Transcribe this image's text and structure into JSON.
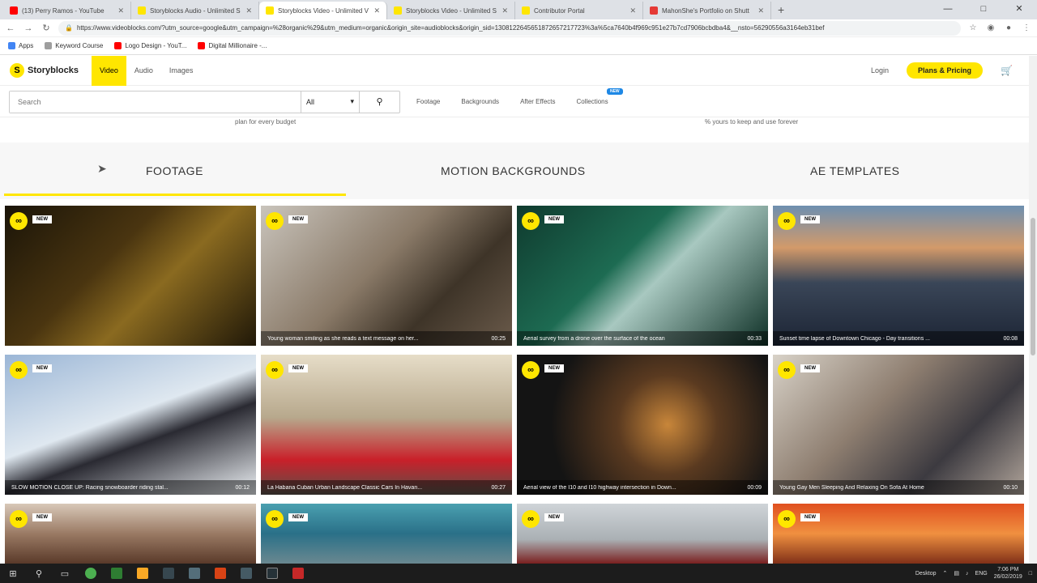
{
  "browser": {
    "tabs": [
      {
        "title": "(13) Perry Ramos - YouTube",
        "color": "#ff0000",
        "active": false
      },
      {
        "title": "Storyblocks Audio - Unlimited S",
        "color": "#ffe600",
        "active": false
      },
      {
        "title": "Storyblocks Video - Unlimited V",
        "color": "#ffe600",
        "active": true
      },
      {
        "title": "Storyblocks Video - Unlimited S",
        "color": "#ffe600",
        "active": false
      },
      {
        "title": "Contributor Portal",
        "color": "#ffe600",
        "active": false
      },
      {
        "title": "MahonShe's Portfolio on Shutt",
        "color": "#e53935",
        "active": false
      }
    ],
    "new_tab": "+",
    "url": "https://www.videoblocks.com/?utm_source=google&utm_campaign=%28organic%29&utm_medium=organic&origin_site=audioblocks&origin_sid=1308122645651872657217723%3a%5ca7640b4f969c951e27b7cd7906bcbdba4&__nsto=56290556a3164eb31bef",
    "bookmarks": [
      {
        "label": "Apps",
        "color": "#4285f4"
      },
      {
        "label": "Keyword Course",
        "color": "#9e9e9e"
      },
      {
        "label": "Logo Design - YouT...",
        "color": "#ff0000"
      },
      {
        "label": "Digital Millionaire -...",
        "color": "#ff0000"
      }
    ]
  },
  "site": {
    "logo_text": "Storyblocks",
    "logo_mark": "S",
    "nav": [
      {
        "label": "Video",
        "active": true
      },
      {
        "label": "Audio",
        "active": false
      },
      {
        "label": "Images",
        "active": false
      }
    ],
    "login": "Login",
    "plans": "Plans & Pricing",
    "search": {
      "placeholder": "Search",
      "select": "All"
    },
    "subnav": [
      "Footage",
      "Backgrounds",
      "After Effects",
      "Collections"
    ],
    "new_badge": "NEW",
    "promo_left": "plan for every budget",
    "promo_right": "% yours to keep and use forever",
    "categories": [
      "FOOTAGE",
      "MOTION BACKGROUNDS",
      "AE TEMPLATES"
    ]
  },
  "cards": [
    {
      "caption": "",
      "duration": "",
      "bg": "linear-gradient(135deg,#1a1408 0%,#4a3510 40%,#8a6a20 60%,#201808 100%)"
    },
    {
      "caption": "Young woman smiling as she reads a text message on her...",
      "duration": "00:25",
      "bg": "linear-gradient(135deg,#c9c4bc 0%,#8a7a68 45%,#3e3428 70%,#6b5b4b 100%)"
    },
    {
      "caption": "Aerial survey from a drone over the surface of the ocean",
      "duration": "00:33",
      "bg": "linear-gradient(135deg,#0f3a2e 0%,#1d6b52 40%,#a8c8c0 55%,#0e3026 100%)"
    },
    {
      "caption": "Sunset time lapse of Downtown Chicago - Day transitions ...",
      "duration": "00:08",
      "bg": "linear-gradient(180deg,#6d8fb0 0%,#d39a6a 30%,#3a4658 55%,#1c2434 100%)"
    },
    {
      "caption": "SLOW MOTION CLOSE UP: Racing snowboarder riding stal...",
      "duration": "00:12",
      "bg": "linear-gradient(160deg,#9bb6d6 0%,#dfe8f0 45%,#2a2a32 60%,#eef2f6 100%)"
    },
    {
      "caption": "La Habana Cuban Urban Landscape Classic Cars In Havan...",
      "duration": "00:27",
      "bg": "linear-gradient(180deg,#e6ddc8 0%,#b7a88c 45%,#c9202a 75%,#5a5048 100%)"
    },
    {
      "caption": "Aerial view of the I10 and I10 highway intersection in Down...",
      "duration": "00:09",
      "bg": "radial-gradient(circle at 60% 50%,#c8863a 0%,#5a3a20 30%,#141414 70%)"
    },
    {
      "caption": "Young Gay Men Sleeping And Relaxing On Sofa At Home",
      "duration": "00:10",
      "bg": "linear-gradient(135deg,#d8d2c8 0%,#8e7e70 40%,#3c3a40 70%,#b0a49a 100%)"
    },
    {
      "caption": "",
      "duration": "",
      "bg": "linear-gradient(180deg,#d8c8b8 0%,#9a7a64 50%,#5a3a2a 100%)"
    },
    {
      "caption": "",
      "duration": "",
      "bg": "linear-gradient(180deg,#4aa0b0 0%,#2a7088 50%,#6a8890 100%)"
    },
    {
      "caption": "",
      "duration": "",
      "bg": "linear-gradient(180deg,#cfd4d8 0%,#aab0b4 60%,#7a2020 100%)"
    },
    {
      "caption": "",
      "duration": "",
      "bg": "linear-gradient(180deg,#e05020 0%,#f09040 50%,#803018 100%)"
    }
  ],
  "taskbar": {
    "lang": "ENG",
    "time": "7:06 PM",
    "date": "26/02/2019",
    "desktop": "Desktop"
  }
}
